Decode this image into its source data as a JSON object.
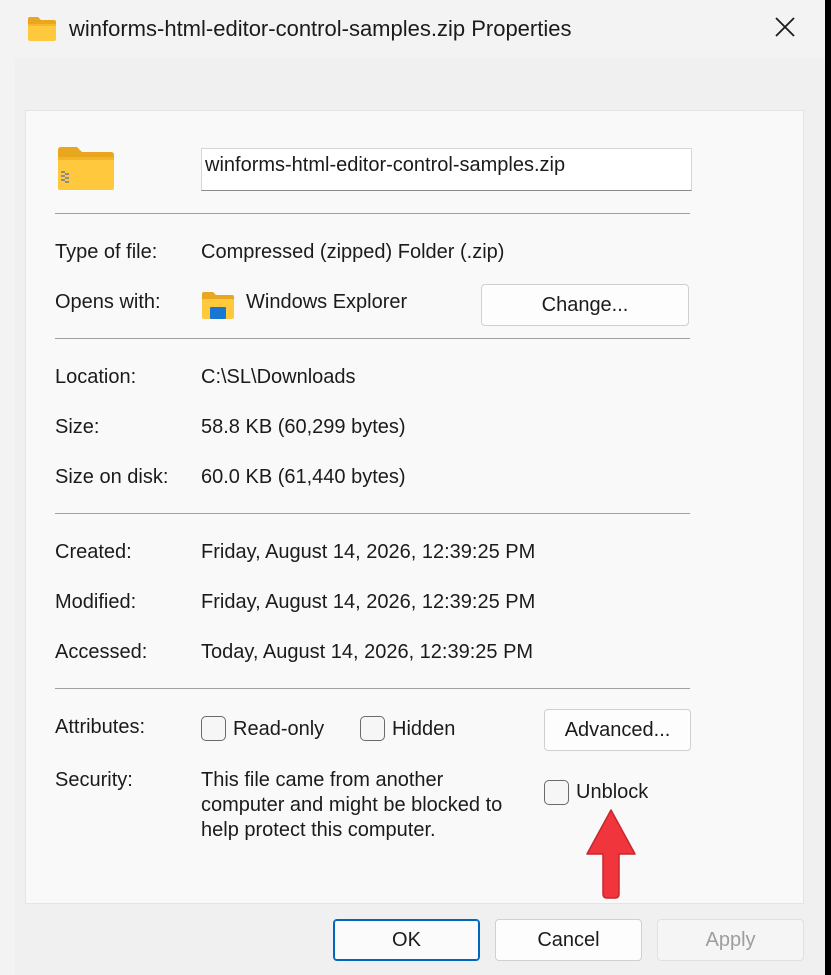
{
  "window": {
    "title": "winforms-html-editor-control-samples.zip Properties",
    "icons": {
      "title": "folder-zip-icon",
      "close": "close-icon"
    }
  },
  "general": {
    "file_name": "winforms-html-editor-control-samples.zip",
    "type_label": "Type of file:",
    "type_value": "Compressed (zipped) Folder (.zip)",
    "opens_label": "Opens with:",
    "opens_value": "Windows Explorer",
    "change_button": "Change...",
    "location_label": "Location:",
    "location_value": "C:\\SL\\Downloads",
    "size_label": "Size:",
    "size_value": "58.8 KB (60,299 bytes)",
    "size_disk_label": "Size on disk:",
    "size_disk_value": "60.0 KB (61,440 bytes)",
    "created_label": "Created:",
    "created_value": "Friday, August 14, 2026, 12:39:25 PM",
    "modified_label": "Modified:",
    "modified_value": "Friday, August 14, 2026, 12:39:25 PM",
    "accessed_label": "Accessed:",
    "accessed_value": "Today, August 14, 2026, 12:39:25 PM",
    "attributes_label": "Attributes:",
    "readonly_label": "Read-only",
    "hidden_label": "Hidden",
    "advanced_button": "Advanced...",
    "security_label": "Security:",
    "security_lines": [
      "This file came from another",
      "computer and might be blocked to",
      "help protect this computer."
    ],
    "unblock_label": "Unblock",
    "readonly_checked": false,
    "hidden_checked": false,
    "unblock_checked": false
  },
  "footer": {
    "ok": "OK",
    "cancel": "Cancel",
    "apply": "Apply"
  },
  "colors": {
    "accent": "#0067c0",
    "annotation_arrow": "#f0353d"
  }
}
